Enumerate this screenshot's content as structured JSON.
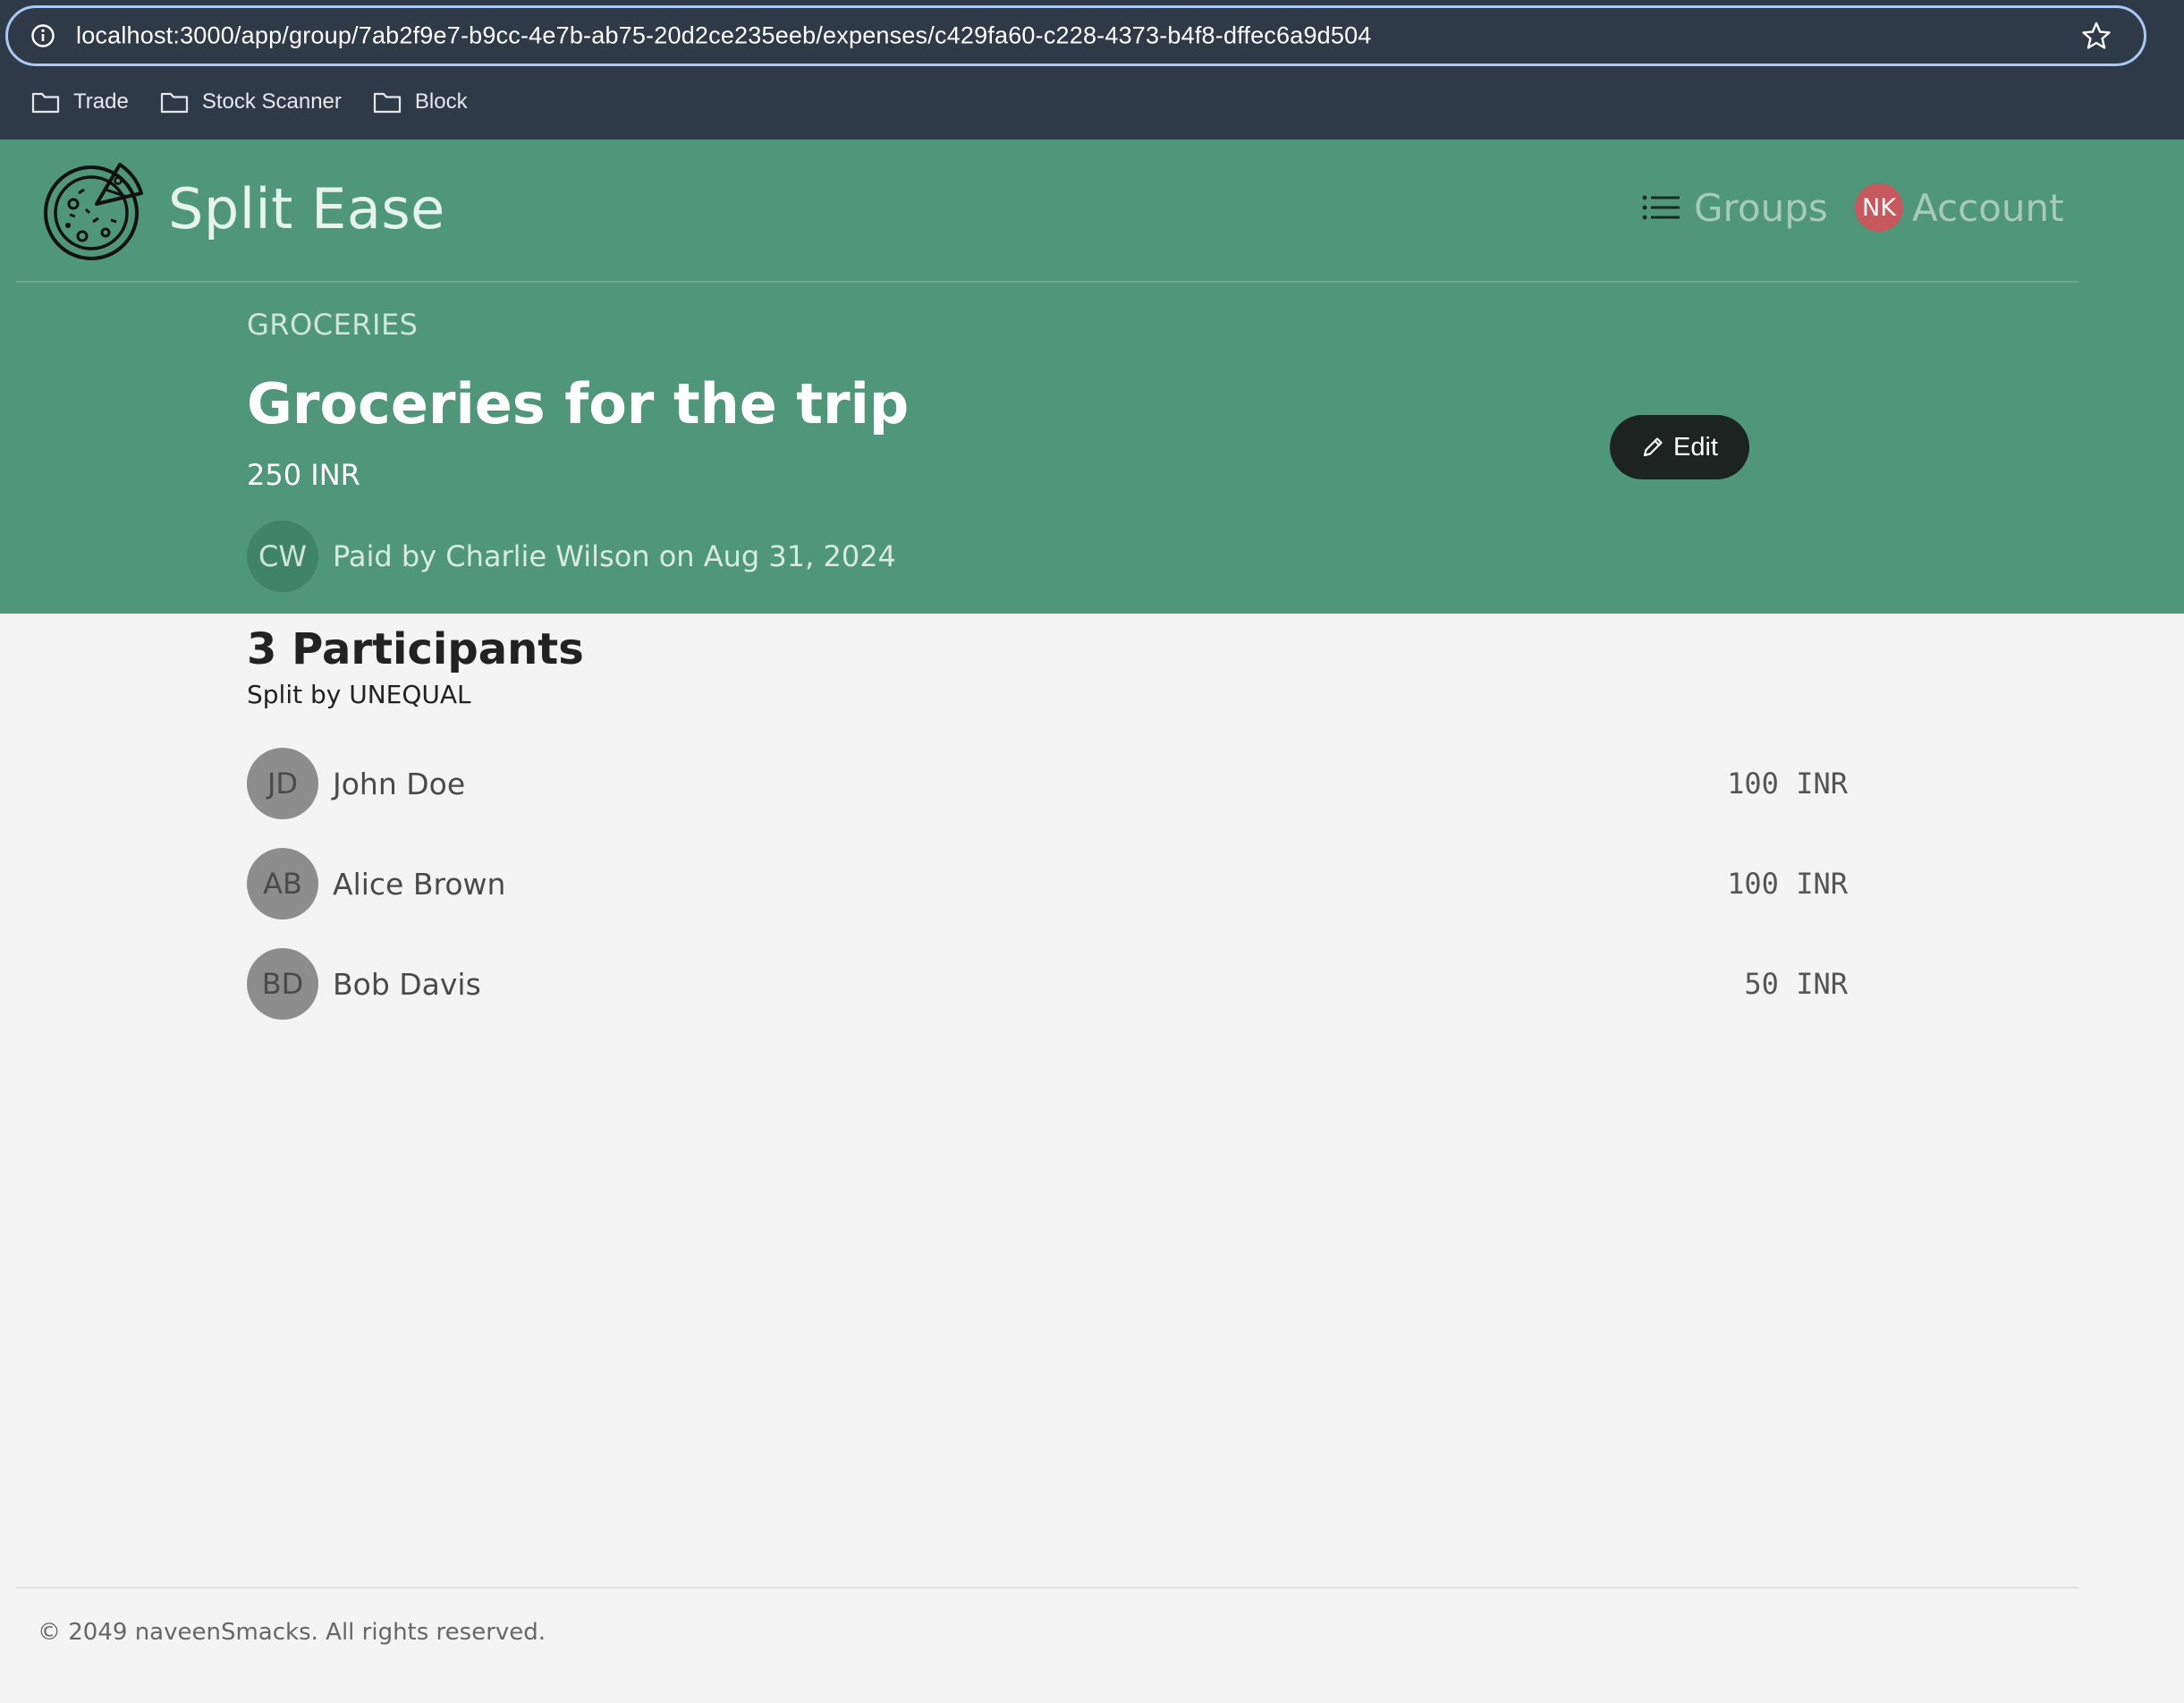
{
  "browser": {
    "url": "localhost:3000/app/group/7ab2f9e7-b9cc-4e7b-ab75-20d2ce235eeb/expenses/c429fa60-c228-4373-b4f8-dffec6a9d504",
    "bookmarks": [
      {
        "label": "Trade",
        "icon": "folder-icon"
      },
      {
        "label": "Stock Scanner",
        "icon": "folder-icon"
      },
      {
        "label": "Block",
        "icon": "folder-icon"
      }
    ]
  },
  "header": {
    "brand": "Split Ease",
    "logo_icon": "pizza-icon",
    "nav": {
      "groups_label": "Groups",
      "account_label": "Account",
      "account_initials": "NK"
    }
  },
  "expense": {
    "category": "GROCERIES",
    "title": "Groceries for the trip",
    "amount": "250 INR",
    "payer_initials": "CW",
    "paid_by_text": "Paid by Charlie Wilson on Aug 31, 2024",
    "edit_label": "Edit"
  },
  "participants": {
    "title": "3 Participants",
    "split_type": "Split by UNEQUAL",
    "items": [
      {
        "initials": "JD",
        "name": "John Doe",
        "amount": "100 INR"
      },
      {
        "initials": "AB",
        "name": "Alice Brown",
        "amount": "100 INR"
      },
      {
        "initials": "BD",
        "name": "Bob Davis",
        "amount": "50 INR"
      }
    ]
  },
  "footer": {
    "text": "© 2049 naveenSmacks. All rights reserved."
  },
  "colors": {
    "header_green": "#50967a",
    "account_avatar": "#c6585e",
    "edit_button": "#1c2320",
    "background": "#f4f4f4"
  }
}
